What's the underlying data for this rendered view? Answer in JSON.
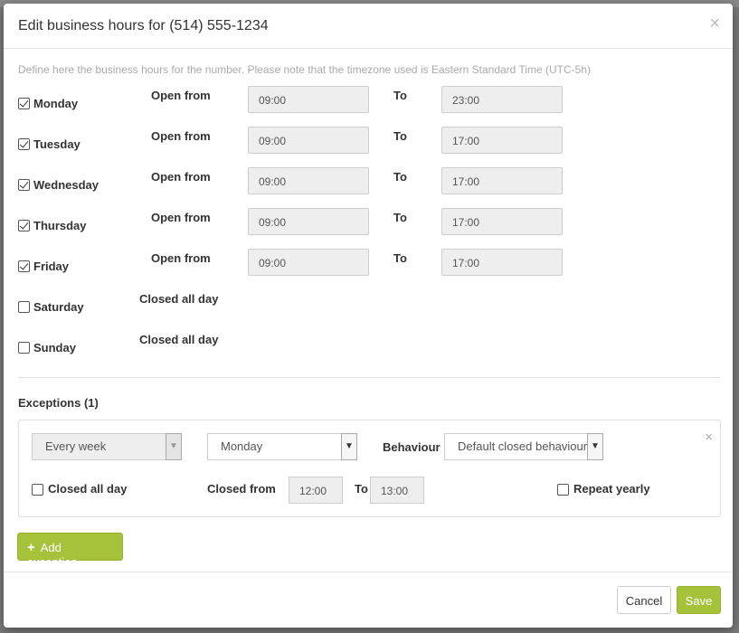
{
  "modal": {
    "title": "Edit business hours for (514) 555-1234",
    "close_icon": "×",
    "intro": "Define here the business hours for the number. Please note that the timezone used is Eastern Standard Time (UTC-5h)"
  },
  "days": [
    {
      "label": "Monday",
      "checked": true,
      "open_label": "Open from",
      "from": "09:00",
      "to_label": "To",
      "to": "23:00"
    },
    {
      "label": "Tuesday",
      "checked": true,
      "open_label": "Open from",
      "from": "09:00",
      "to_label": "To",
      "to": "17:00"
    },
    {
      "label": "Wednesday",
      "checked": true,
      "open_label": "Open from",
      "from": "09:00",
      "to_label": "To",
      "to": "17:00"
    },
    {
      "label": "Thursday",
      "checked": true,
      "open_label": "Open from",
      "from": "09:00",
      "to_label": "To",
      "to": "17:00"
    },
    {
      "label": "Friday",
      "checked": true,
      "open_label": "Open from",
      "from": "09:00",
      "to_label": "To",
      "to": "17:00"
    },
    {
      "label": "Saturday",
      "checked": false,
      "closed_label": "Closed all day"
    },
    {
      "label": "Sunday",
      "checked": false,
      "closed_label": "Closed all day"
    }
  ],
  "exceptions": {
    "title": "Exceptions (1)",
    "items": [
      {
        "frequency": "Every week",
        "day": "Monday",
        "behaviour_label": "Behaviour",
        "behaviour": "Default closed behaviour",
        "closed_all_day_label": "Closed all day",
        "closed_from_label": "Closed from",
        "closed_from": "12:00",
        "to_label": "To",
        "to": "13:00",
        "repeat_yearly_label": "Repeat yearly",
        "close_icon": "×"
      }
    ],
    "add_label": "Add exception",
    "add_icon": "+"
  },
  "footer": {
    "cancel_label": "Cancel",
    "save_label": "Save"
  },
  "colors": {
    "accent": "#a6c23b",
    "accent_border": "#97b12f",
    "muted_text": "#aaaaaa",
    "input_bg": "#eeeeee"
  }
}
